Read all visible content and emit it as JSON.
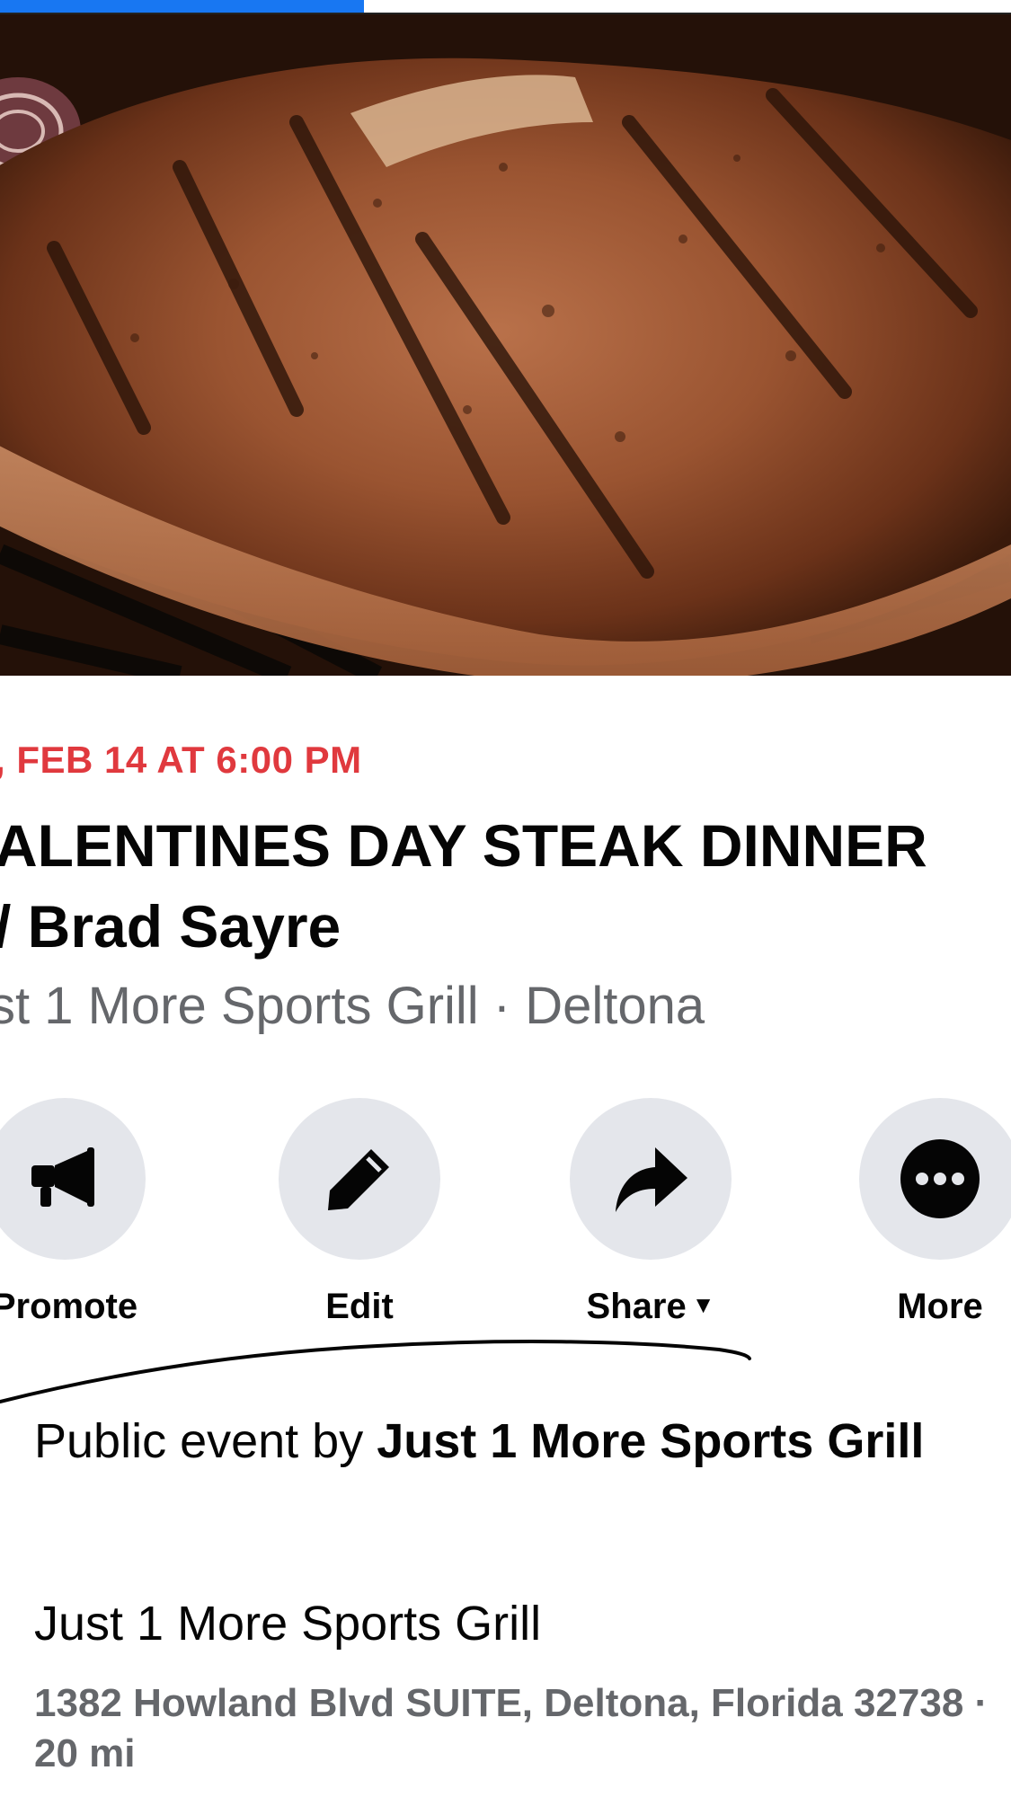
{
  "story_progress": {
    "fraction": 0.36,
    "color": "#1877f2"
  },
  "event": {
    "date_time": ", FEB 14 AT 6:00 PM",
    "title_line1": "ALENTINES DAY STEAK DINNER",
    "title_line2": "/ Brad Sayre",
    "subtitle": "st 1 More Sports Grill · Deltona",
    "accent_color": "#e0393e"
  },
  "actions": [
    {
      "label": "Promote",
      "icon": "megaphone-icon"
    },
    {
      "label": "Edit",
      "icon": "pencil-icon"
    },
    {
      "label": "Share",
      "icon": "share-arrow-icon",
      "has_dropdown": true
    },
    {
      "label": "More",
      "icon": "more-dots-icon"
    }
  ],
  "host": {
    "prefix": "Public event by ",
    "name": "Just 1 More Sports Grill"
  },
  "venue": {
    "name": "Just 1 More Sports Grill",
    "address": "1382 Howland Blvd SUITE, Deltona, Florida 32738 · 20 mi"
  }
}
